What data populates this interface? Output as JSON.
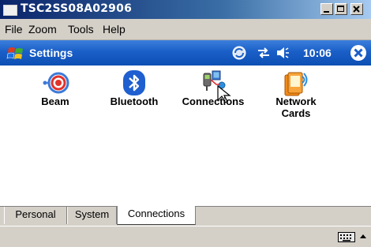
{
  "window": {
    "title": "TSC2SS08A02906"
  },
  "menu": [
    "File",
    "Zoom",
    "Tools",
    "Help"
  ],
  "navbar": {
    "title": "Settings",
    "time": "10:06"
  },
  "apps": [
    {
      "label": "Beam",
      "icon": "beam-icon"
    },
    {
      "label": "Bluetooth",
      "icon": "bluetooth-icon"
    },
    {
      "label": "Connections",
      "icon": "connections-icon"
    },
    {
      "label": "Network Cards",
      "label_line1": "Network",
      "label_line2": "Cards",
      "icon": "network-cards-icon"
    }
  ],
  "tabs": [
    {
      "label": "Personal",
      "active": false
    },
    {
      "label": "System",
      "active": false
    },
    {
      "label": "Connections",
      "active": true
    }
  ],
  "colors": {
    "navbar": "#1a5fc8",
    "titlebar": "#0a246a",
    "chrome": "#d4d0c8"
  }
}
